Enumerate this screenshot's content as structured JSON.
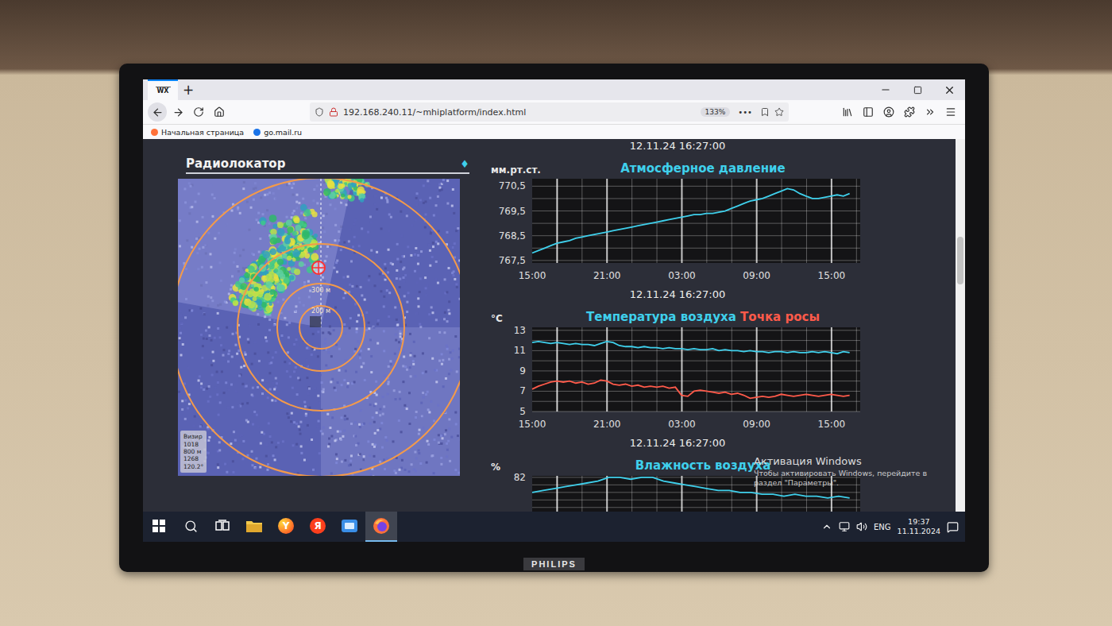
{
  "monitor": {
    "brand": "PHILIPS"
  },
  "browser": {
    "tab_logo": "WX",
    "new_tab": "+",
    "url": "192.168.240.11/~mhiplatform/index.html",
    "zoom": "133%",
    "more": "•••",
    "bookmarks": [
      "Начальная страница",
      "go.mail.ru"
    ]
  },
  "scrollbar": {
    "level": 0.3
  },
  "radar": {
    "title": "Радиолокатор",
    "marker": "♦",
    "ring_labels": [
      "300 м",
      "200 м"
    ],
    "visir": [
      "Визир",
      "1018",
      "800 м",
      "1268",
      "120.2°"
    ]
  },
  "charts": [
    {
      "date": "12.11.24 16:27:00",
      "unit": "мм.рт.ст.",
      "titles": [
        {
          "text": "Атмосферное давление",
          "color": "#3fd0ec"
        }
      ],
      "y_ticks": [
        {
          "label": "770,5",
          "value": 770.5
        },
        {
          "label": "769,5",
          "value": 769.5
        },
        {
          "label": "768,5",
          "value": 768.5
        },
        {
          "label": "767,5",
          "value": 767.5
        }
      ],
      "y_min": 767.4,
      "y_max": 770.8,
      "x_ticks": [
        "15:00",
        "21:00",
        "03:00",
        "09:00",
        "15:00"
      ],
      "series": [
        {
          "color": "#3fd0ec",
          "values": [
            767.8,
            767.9,
            768.0,
            768.1,
            768.2,
            768.25,
            768.3,
            768.4,
            768.45,
            768.5,
            768.55,
            768.6,
            768.65,
            768.7,
            768.75,
            768.8,
            768.85,
            768.9,
            768.95,
            769.0,
            769.05,
            769.1,
            769.15,
            769.2,
            769.25,
            769.3,
            769.35,
            769.35,
            769.4,
            769.4,
            769.45,
            769.5,
            769.6,
            769.7,
            769.8,
            769.9,
            769.95,
            770.0,
            770.1,
            770.2,
            770.3,
            770.4,
            770.35,
            770.2,
            770.1,
            770.0,
            770.0,
            770.05,
            770.1,
            770.15,
            770.1,
            770.2
          ]
        }
      ]
    },
    {
      "date": "12.11.24 16:27:00",
      "unit": "°C",
      "titles": [
        {
          "text": "Температура воздуха",
          "color": "#3fd0ec"
        },
        {
          "text": "Точка росы",
          "color": "#ff5a4a"
        }
      ],
      "y_ticks": [
        {
          "label": "13",
          "value": 13
        },
        {
          "label": "11",
          "value": 11
        },
        {
          "label": "9",
          "value": 9
        },
        {
          "label": "7",
          "value": 7
        },
        {
          "label": "5",
          "value": 5
        }
      ],
      "y_min": 5,
      "y_max": 13.3,
      "x_ticks": [
        "15:00",
        "21:00",
        "03:00",
        "09:00",
        "15:00"
      ],
      "series": [
        {
          "color": "#3fd0ec",
          "values": [
            11.8,
            11.9,
            11.8,
            11.7,
            11.8,
            11.7,
            11.6,
            11.7,
            11.6,
            11.6,
            11.5,
            11.7,
            11.9,
            11.8,
            11.5,
            11.4,
            11.4,
            11.3,
            11.4,
            11.3,
            11.3,
            11.2,
            11.3,
            11.2,
            11.2,
            11.1,
            11.2,
            11.1,
            11.1,
            11.2,
            11.0,
            11.1,
            11.0,
            11.0,
            10.9,
            11.0,
            10.9,
            10.9,
            10.8,
            10.9,
            10.9,
            10.8,
            10.9,
            10.8,
            10.8,
            10.9,
            10.8,
            10.9,
            10.8,
            10.7,
            10.9,
            10.8
          ]
        },
        {
          "color": "#ff5a4a",
          "values": [
            7.2,
            7.5,
            7.7,
            7.9,
            8.0,
            7.9,
            8.0,
            7.8,
            7.9,
            7.7,
            7.8,
            8.1,
            8.0,
            7.7,
            7.6,
            7.7,
            7.5,
            7.6,
            7.4,
            7.5,
            7.4,
            7.5,
            7.3,
            7.4,
            6.6,
            6.5,
            7.0,
            7.1,
            7.0,
            6.9,
            6.8,
            6.9,
            6.7,
            6.8,
            6.6,
            6.3,
            6.4,
            6.5,
            6.4,
            6.5,
            6.7,
            6.6,
            6.5,
            6.6,
            6.7,
            6.6,
            6.5,
            6.6,
            6.7,
            6.6,
            6.5,
            6.6
          ]
        }
      ]
    },
    {
      "date": "12.11.24 16:27:00",
      "unit": "%",
      "titles": [
        {
          "text": "Влажность воздуха",
          "color": "#3fd0ec"
        }
      ],
      "y_ticks": [
        {
          "label": "82",
          "value": 82
        }
      ],
      "y_min": 60,
      "y_max": 82.4,
      "x_ticks": [],
      "series": [
        {
          "color": "#3fd0ec",
          "values": [
            78,
            78.5,
            79,
            79.5,
            80,
            80.5,
            81,
            82,
            82,
            81.5,
            82,
            82,
            81,
            80.5,
            80,
            79.5,
            79,
            78.5,
            78.5,
            78,
            78,
            77.5,
            77.5,
            77,
            77.5,
            77,
            77,
            76.5,
            77,
            76.5
          ]
        }
      ]
    }
  ],
  "watermark": {
    "title": "Активация Windows",
    "text": "Чтобы активировать Windows, перейдите в раздел \"Параметры\"."
  },
  "taskbar": {
    "apps": [
      {
        "kind": "folder",
        "selected": false
      },
      {
        "kind": "yandex-browser",
        "label": "Y",
        "selected": false
      },
      {
        "kind": "yandex",
        "label": "Я",
        "selected": false
      },
      {
        "kind": "app",
        "selected": false
      },
      {
        "kind": "firefox",
        "selected": true
      }
    ],
    "tray": {
      "language": "ENG",
      "time": "19:37",
      "date": "11.11.2024"
    }
  }
}
